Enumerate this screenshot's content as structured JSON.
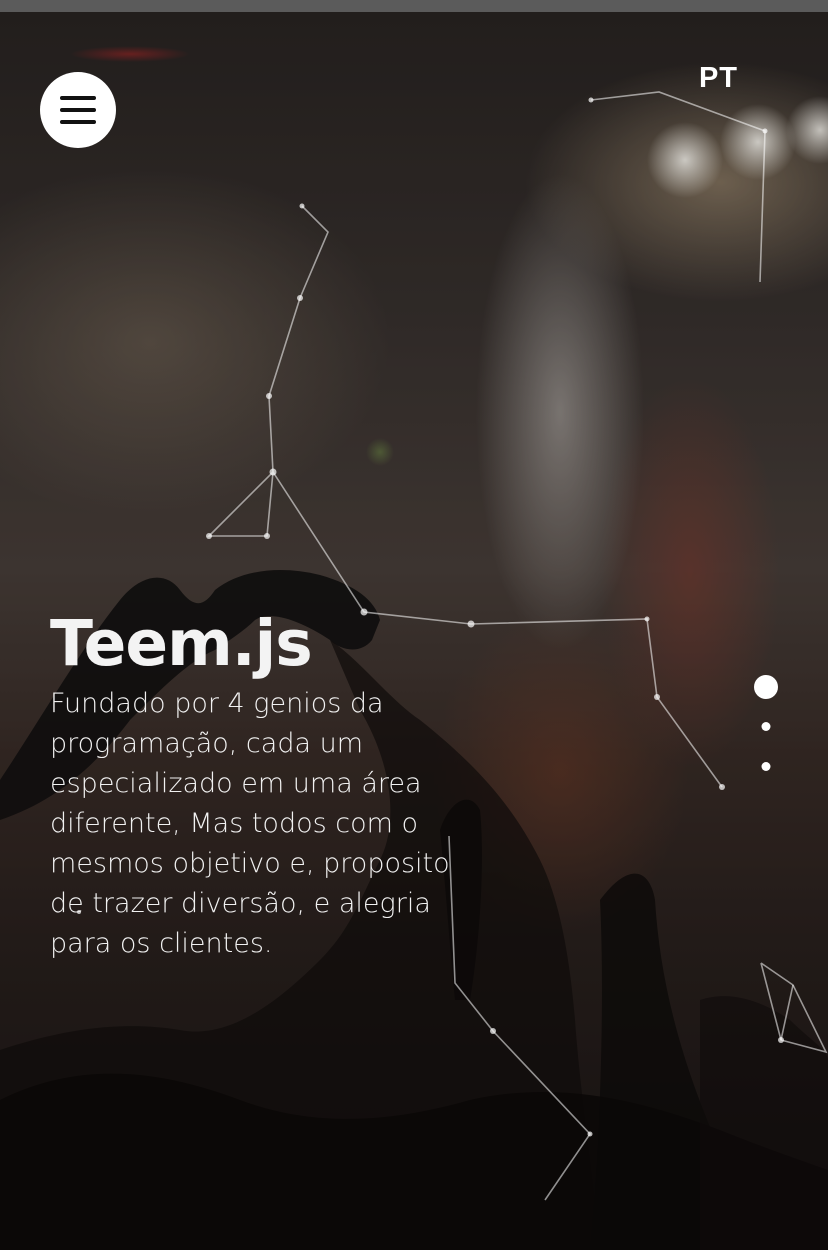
{
  "header": {
    "menu_icon": "hamburger-menu-icon",
    "language": "PT"
  },
  "hero": {
    "title": "Teem.js",
    "description": "Fundado por 4 genios da programação, cada um especializado em uma área diferente, Mas todos com o mesmos objetivo e, proposito de trazer diversão, e alegria para os clientes."
  },
  "slides": {
    "count": 3,
    "active": 1
  },
  "colors": {
    "text": "#ffffff",
    "menu_button_bg": "#ffffff",
    "menu_icon": "#111111",
    "top_bar": "#5b5b5b"
  }
}
